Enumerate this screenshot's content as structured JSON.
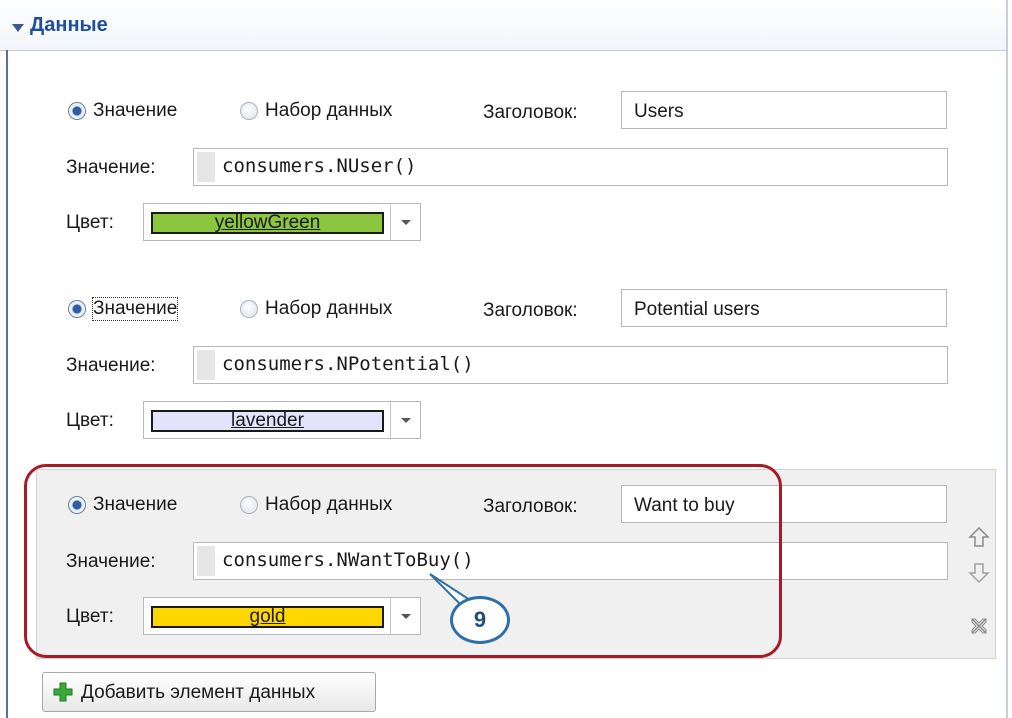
{
  "section": {
    "title": "Данные"
  },
  "labels": {
    "radio_value": "Значение",
    "radio_dataset": "Набор данных",
    "caption": "Заголовок:",
    "value": "Значение:",
    "color": "Цвет:"
  },
  "items": [
    {
      "caption": "Users",
      "expression": "consumers.NUser()",
      "color_name": "yellowGreen",
      "color_hex": "#9acd32",
      "mode": "value"
    },
    {
      "caption": "Potential users",
      "expression": "consumers.NPotential()",
      "color_name": "lavender",
      "color_hex": "#e6e6fa",
      "mode": "value"
    },
    {
      "caption": "Want to buy",
      "expression": "consumers.NWantToBuy()",
      "color_name": "gold",
      "color_hex": "#ffd700",
      "mode": "value"
    }
  ],
  "callout": {
    "number": "9"
  },
  "add_button": {
    "label": "Добавить элемент данных",
    "icon": "plus-icon"
  },
  "side_icons": [
    "move-up-icon",
    "move-down-icon",
    "remove-icon"
  ],
  "colors": {
    "accent": "#1f4e9c",
    "highlight_frame": "#a51c24",
    "callout_border": "#2f6fa8"
  }
}
